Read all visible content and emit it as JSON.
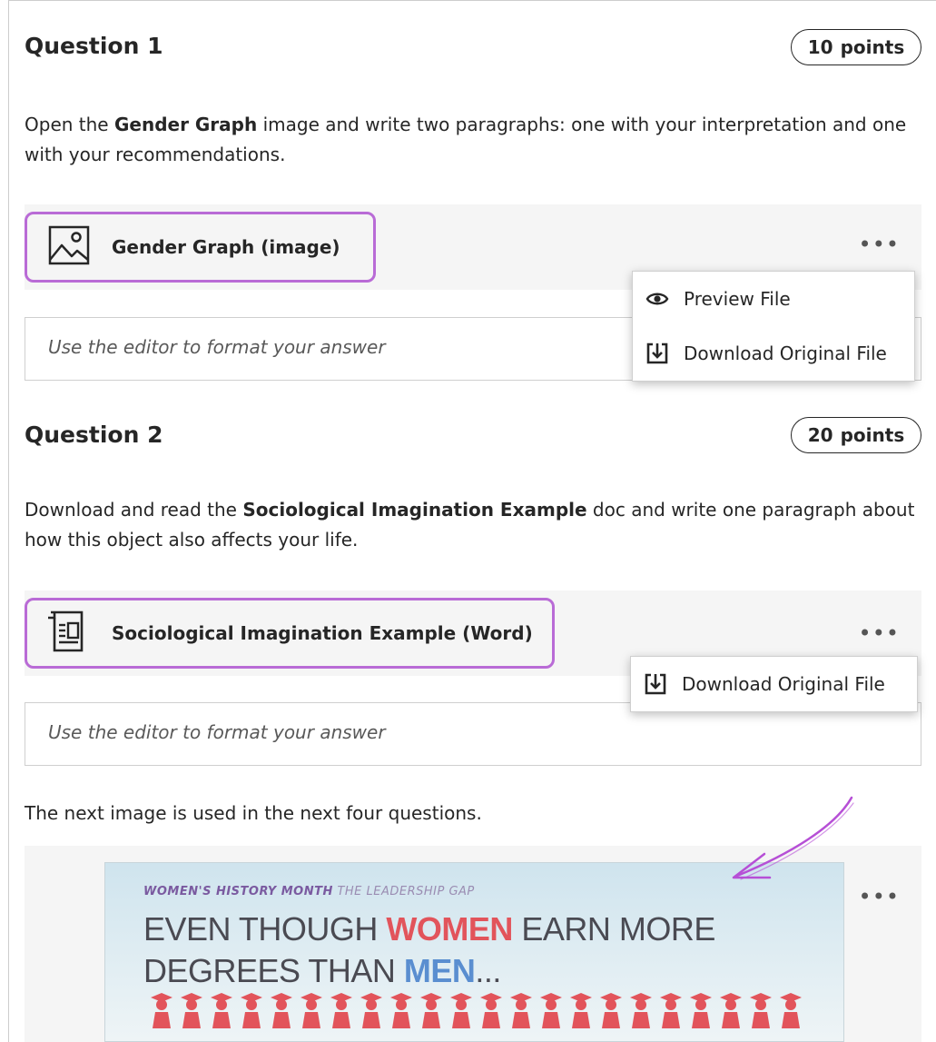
{
  "question1": {
    "title": "Question 1",
    "points_value": "10",
    "points_label": "points",
    "text_before": "Open the ",
    "text_bold": "Gender Graph",
    "text_after": " image and write two paragraphs: one with your interpretation and one with your recommendations.",
    "file_name": "Gender Graph (image)",
    "more_label": "•••",
    "menu": [
      {
        "label": "Preview File",
        "icon": "eye-icon"
      },
      {
        "label": "Download Original File",
        "icon": "download-icon"
      }
    ],
    "answer_placeholder": "Use the editor to format your answer"
  },
  "question2": {
    "title": "Question 2",
    "points_value": "20",
    "points_label": "points",
    "text_before": "Download and read the ",
    "text_bold": "Sociological Imagination Example",
    "text_after": " doc and write one paragraph about how this object also affects your life.",
    "file_name": "Sociological Imagination Example (Word)",
    "more_label": "•••",
    "menu": [
      {
        "label": "Download Original File",
        "icon": "download-icon"
      }
    ],
    "answer_placeholder": "Use the editor to format your answer"
  },
  "intro_text": "The next image is used in the next four questions.",
  "image_block": {
    "more_label": "•••",
    "tag_bold": "WOMEN'S HISTORY MONTH",
    "tag_rest": " THE LEADERSHIP GAP",
    "head_1": "EVEN THOUGH ",
    "head_women": "WOMEN",
    "head_2": " EARN MORE",
    "head_3": "DEGREES THAN ",
    "head_men": "MEN",
    "head_4": "..."
  },
  "colors": {
    "highlight": "#b96bd6",
    "women": "#e2545b",
    "men": "#5a8ed0"
  }
}
